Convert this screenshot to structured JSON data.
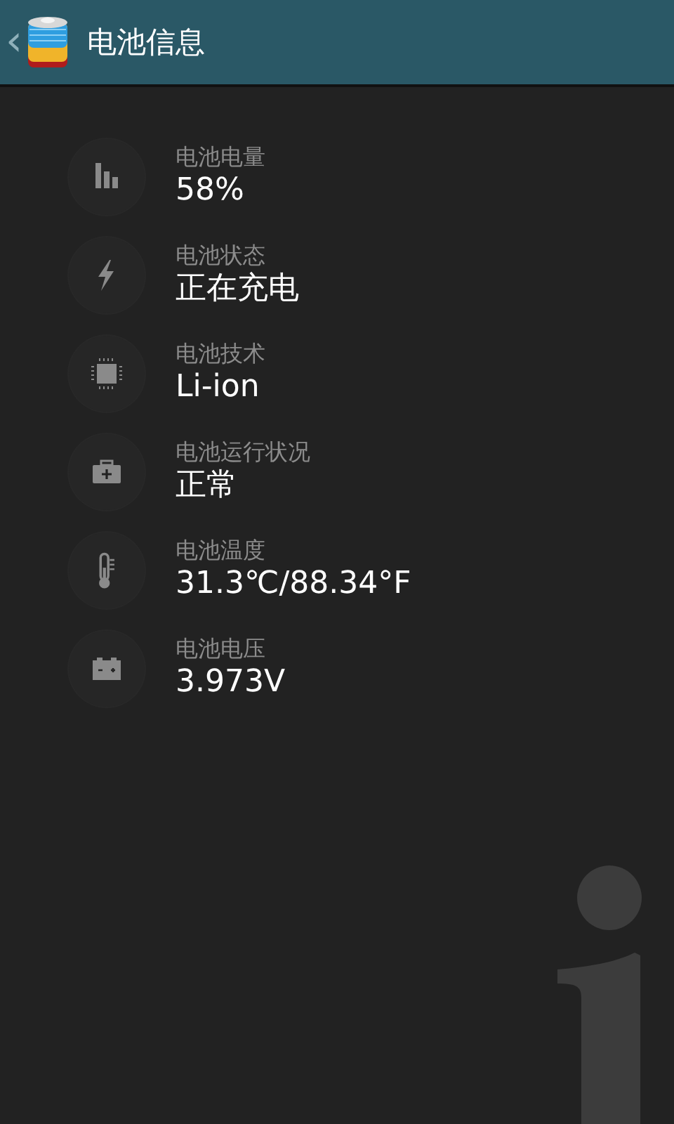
{
  "header": {
    "back": "‹",
    "title": "电池信息"
  },
  "items": [
    {
      "kind": "level",
      "label": "电池电量",
      "value": "58%"
    },
    {
      "kind": "status",
      "label": "电池状态",
      "value": "正在充电"
    },
    {
      "kind": "technology",
      "label": "电池技术",
      "value": "Li-ion"
    },
    {
      "kind": "health",
      "label": "电池运行状况",
      "value": "正常"
    },
    {
      "kind": "temperature",
      "label": "电池温度",
      "value": "31.3℃/88.34°F"
    },
    {
      "kind": "voltage",
      "label": "电池电压",
      "value": "3.973V"
    }
  ]
}
